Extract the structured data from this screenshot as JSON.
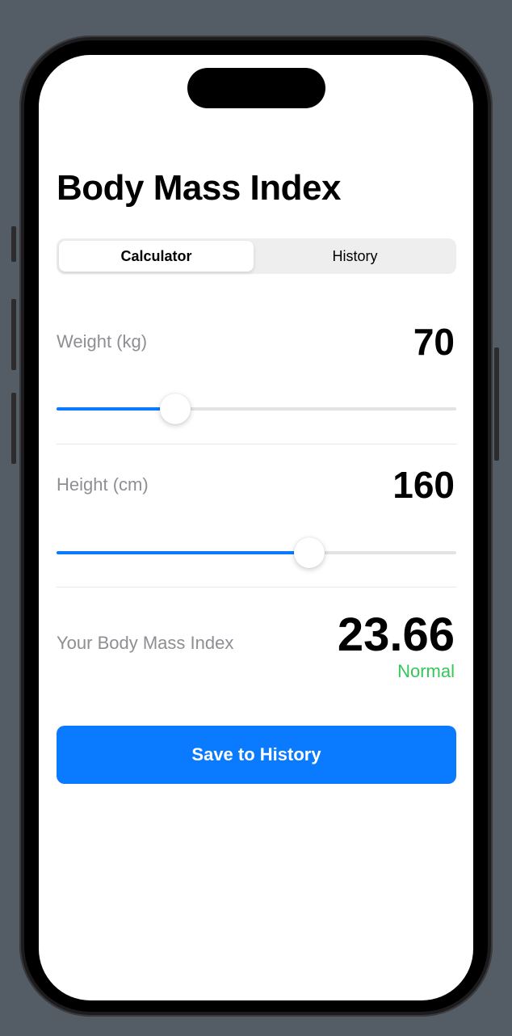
{
  "screen": {
    "title": "Body Mass Index"
  },
  "tabs": {
    "items": [
      "Calculator",
      "History"
    ],
    "selected": "Calculator"
  },
  "weight": {
    "label": "Weight (kg)",
    "value": "70",
    "slider_fraction": 0.296
  },
  "height": {
    "label": "Height (cm)",
    "value": "160",
    "slider_fraction": 0.632
  },
  "result": {
    "label": "Your Body Mass Index",
    "value": "23.66",
    "status": "Normal"
  },
  "actions": {
    "save_label": "Save to History"
  },
  "colors": {
    "accent": "#0a7bff",
    "status_normal": "#34c759",
    "label_gray": "#8e8e93"
  }
}
